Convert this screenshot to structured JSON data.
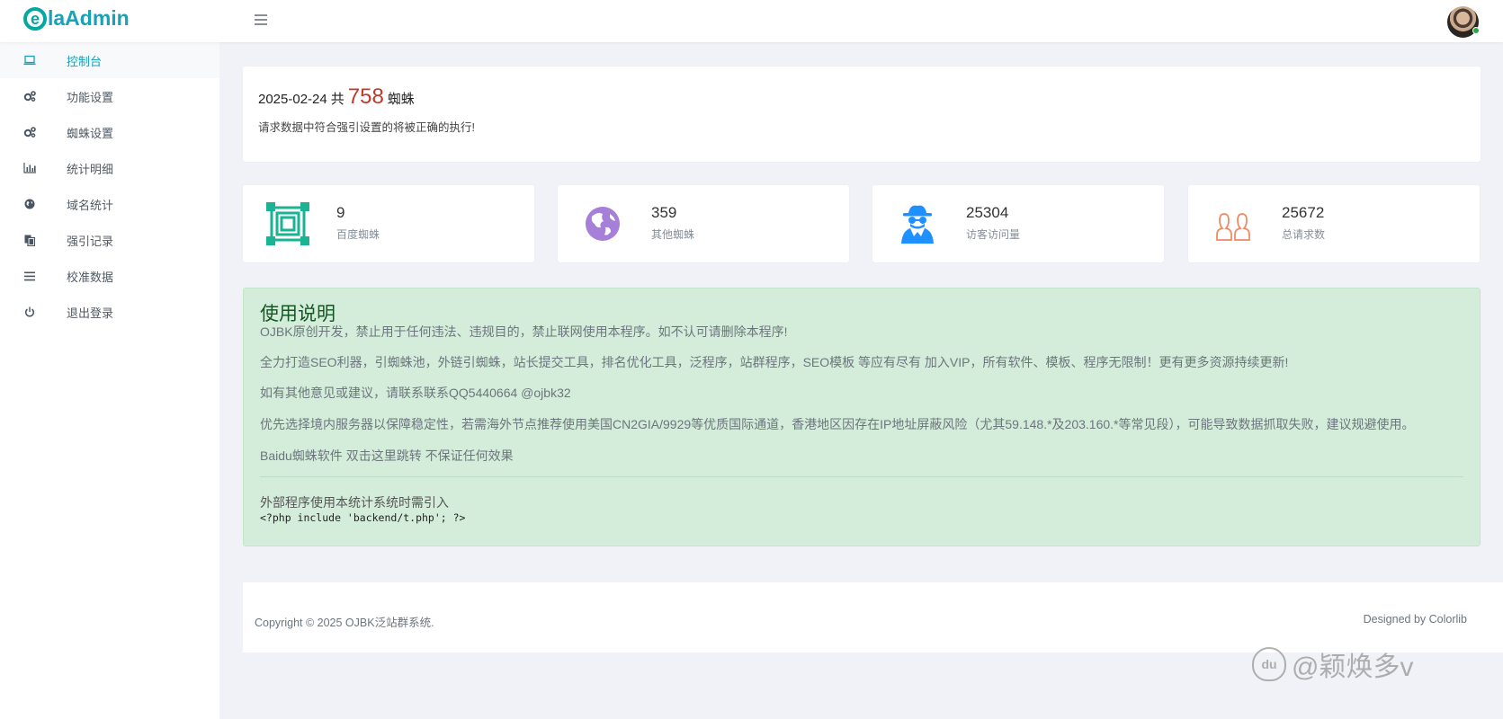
{
  "header": {
    "logo_letter": "e",
    "logo_text": "laAdmin"
  },
  "sidebar": {
    "items": [
      {
        "label": "控制台",
        "icon": "laptop-icon"
      },
      {
        "label": "功能设置",
        "icon": "gears-icon"
      },
      {
        "label": "蜘蛛设置",
        "icon": "gears-icon"
      },
      {
        "label": "统计明细",
        "icon": "bar-chart-icon"
      },
      {
        "label": "域名统计",
        "icon": "globe-icon"
      },
      {
        "label": "强引记录",
        "icon": "copy-icon"
      },
      {
        "label": "校准数据",
        "icon": "list-icon"
      },
      {
        "label": "退出登录",
        "icon": "power-icon"
      }
    ]
  },
  "welcome": {
    "date": "2025-02-24",
    "prefix": "共",
    "count": "758",
    "suffix": "蜘蛛",
    "subtitle": "请求数据中符合强引设置的将被正确的执行!"
  },
  "stats": [
    {
      "value": "9",
      "label": "百度蜘蛛",
      "icon": "frame-icon",
      "color": "#1ab394"
    },
    {
      "value": "359",
      "label": "其他蜘蛛",
      "icon": "globe-americas-icon",
      "color": "#a57fd8"
    },
    {
      "value": "25304",
      "label": "访客访问量",
      "icon": "spy-icon",
      "color": "#1e90ff"
    },
    {
      "value": "25672",
      "label": "总请求数",
      "icon": "users-icon",
      "color": "#f08a65"
    }
  ],
  "notice": {
    "title": "使用说明",
    "lines": [
      "OJBK原创开发，禁止用于任何违法、违规目的，禁止联网使用本程序。如不认可请删除本程序!",
      "全力打造SEO利器，引蜘蛛池，外链引蜘蛛，站长提交工具，排名优化工具，泛程序，站群程序，SEO模板 等应有尽有 加入VIP，所有软件、模板、程序无限制！更有更多资源持续更新!",
      "如有其他意见或建议，请联系联系QQ5440664 @ojbk32",
      "优先选择境内服务器以保障稳定性，若需海外节点推荐使用美国CN2GIA/9929等优质国际通道，香港地区因存在IP地址屏蔽风险（尤其59.148.*及203.160.*等常见段），可能导致数据抓取失败，建议规避使用。",
      "Baidu蜘蛛软件 双击这里跳转 不保证任何效果"
    ],
    "code_title": "外部程序使用本统计系统时需引入",
    "code": "<?php include 'backend/t.php'; ?>"
  },
  "footer": {
    "copyright": "Copyright © 2025 OJBK泛站群系统.",
    "designed_by": "Designed by Colorlib"
  },
  "watermark": {
    "paw_text": "du",
    "text": "@颖焕多v"
  }
}
